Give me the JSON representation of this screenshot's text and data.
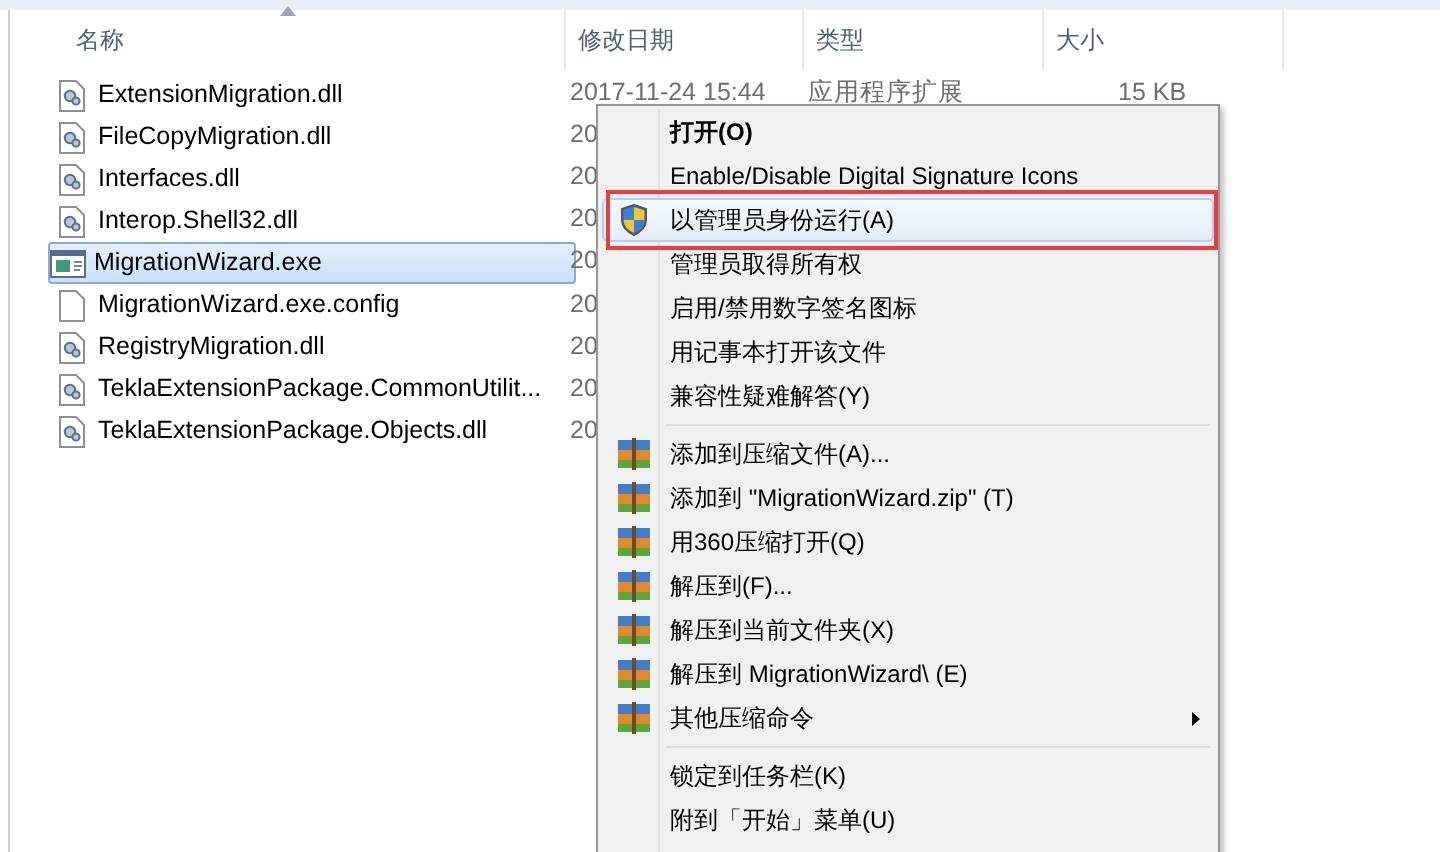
{
  "columns": [
    {
      "label": "名称",
      "sorted": true
    },
    {
      "label": "修改日期",
      "sorted": false
    },
    {
      "label": "类型",
      "sorted": false
    },
    {
      "label": "大小",
      "sorted": false
    }
  ],
  "files": [
    {
      "name": "ExtensionMigration.dll",
      "kind": "dll",
      "selected": false,
      "date": "2017-11-24 15:44",
      "type": "应用程序扩展",
      "size": "15 KB"
    },
    {
      "name": "FileCopyMigration.dll",
      "kind": "dll",
      "selected": false,
      "date": "20"
    },
    {
      "name": "Interfaces.dll",
      "kind": "dll",
      "selected": false,
      "date": "20"
    },
    {
      "name": "Interop.Shell32.dll",
      "kind": "dll",
      "selected": false,
      "date": "20"
    },
    {
      "name": "MigrationWizard.exe",
      "kind": "exe",
      "selected": true,
      "date": "20"
    },
    {
      "name": "MigrationWizard.exe.config",
      "kind": "blank",
      "selected": false,
      "date": "20"
    },
    {
      "name": "RegistryMigration.dll",
      "kind": "dll",
      "selected": false,
      "date": "20"
    },
    {
      "name": "TeklaExtensionPackage.CommonUtilit...",
      "kind": "dll",
      "selected": false,
      "date": "20"
    },
    {
      "name": "TeklaExtensionPackage.Objects.dll",
      "kind": "dll",
      "selected": false,
      "date": "20"
    }
  ],
  "context_menu": {
    "groups": [
      [
        {
          "label": "打开(O)",
          "kind": "plain",
          "default": true,
          "selected": false
        },
        {
          "label": "Enable/Disable Digital Signature Icons",
          "kind": "plain",
          "default": false,
          "selected": false
        },
        {
          "label": "以管理员身份运行(A)",
          "kind": "shield",
          "default": false,
          "selected": true
        },
        {
          "label": "管理员取得所有权",
          "kind": "plain",
          "default": false,
          "selected": false
        },
        {
          "label": "启用/禁用数字签名图标",
          "kind": "plain",
          "default": false,
          "selected": false
        },
        {
          "label": "用记事本打开该文件",
          "kind": "plain",
          "default": false,
          "selected": false
        },
        {
          "label": "兼容性疑难解答(Y)",
          "kind": "plain",
          "default": false,
          "selected": false
        }
      ],
      [
        {
          "label": "添加到压缩文件(A)...",
          "kind": "archive",
          "default": false,
          "selected": false
        },
        {
          "label": "添加到 \"MigrationWizard.zip\" (T)",
          "kind": "archive",
          "default": false,
          "selected": false
        },
        {
          "label": "用360压缩打开(Q)",
          "kind": "archive",
          "default": false,
          "selected": false
        },
        {
          "label": "解压到(F)...",
          "kind": "archive",
          "default": false,
          "selected": false
        },
        {
          "label": "解压到当前文件夹(X)",
          "kind": "archive",
          "default": false,
          "selected": false
        },
        {
          "label": "解压到 MigrationWizard\\ (E)",
          "kind": "archive",
          "default": false,
          "selected": false
        },
        {
          "label": "其他压缩命令",
          "kind": "archive_submenu",
          "default": false,
          "selected": false
        }
      ],
      [
        {
          "label": "锁定到任务栏(K)",
          "kind": "plain",
          "default": false,
          "selected": false
        },
        {
          "label": "附到「开始」菜单(U)",
          "kind": "plain",
          "default": false,
          "selected": false
        }
      ]
    ]
  }
}
